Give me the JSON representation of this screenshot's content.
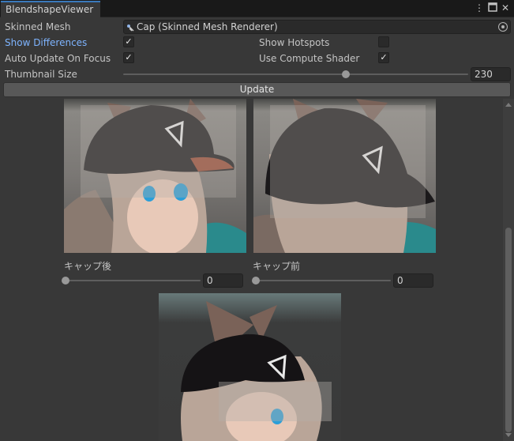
{
  "window": {
    "tab_title": "BlendshapeViewer"
  },
  "fields": {
    "skinned_mesh_label": "Skinned Mesh",
    "skinned_mesh_value": "Cap (Skinned Mesh Renderer)",
    "show_differences_label": "Show Differences",
    "show_differences_checked": true,
    "show_hotspots_label": "Show Hotspots",
    "show_hotspots_checked": false,
    "auto_update_label": "Auto Update On Focus",
    "auto_update_checked": true,
    "compute_shader_label": "Use Compute Shader",
    "compute_shader_checked": true,
    "thumbnail_size_label": "Thumbnail Size",
    "thumbnail_size_value": "230",
    "update_button": "Update"
  },
  "blendshapes": [
    {
      "name": "キャップ後",
      "weight": "0"
    },
    {
      "name": "キャップ前",
      "weight": "0"
    }
  ],
  "icons": {
    "more": "vertical-ellipsis-icon",
    "maximize": "maximize-icon",
    "close": "close-icon",
    "mesh": "skinned-mesh-icon",
    "picker": "object-picker-icon",
    "check": "checkmark-icon"
  },
  "colors": {
    "background": "#383838",
    "tab_accent": "#3a79bb",
    "link": "#7eb4ff"
  }
}
